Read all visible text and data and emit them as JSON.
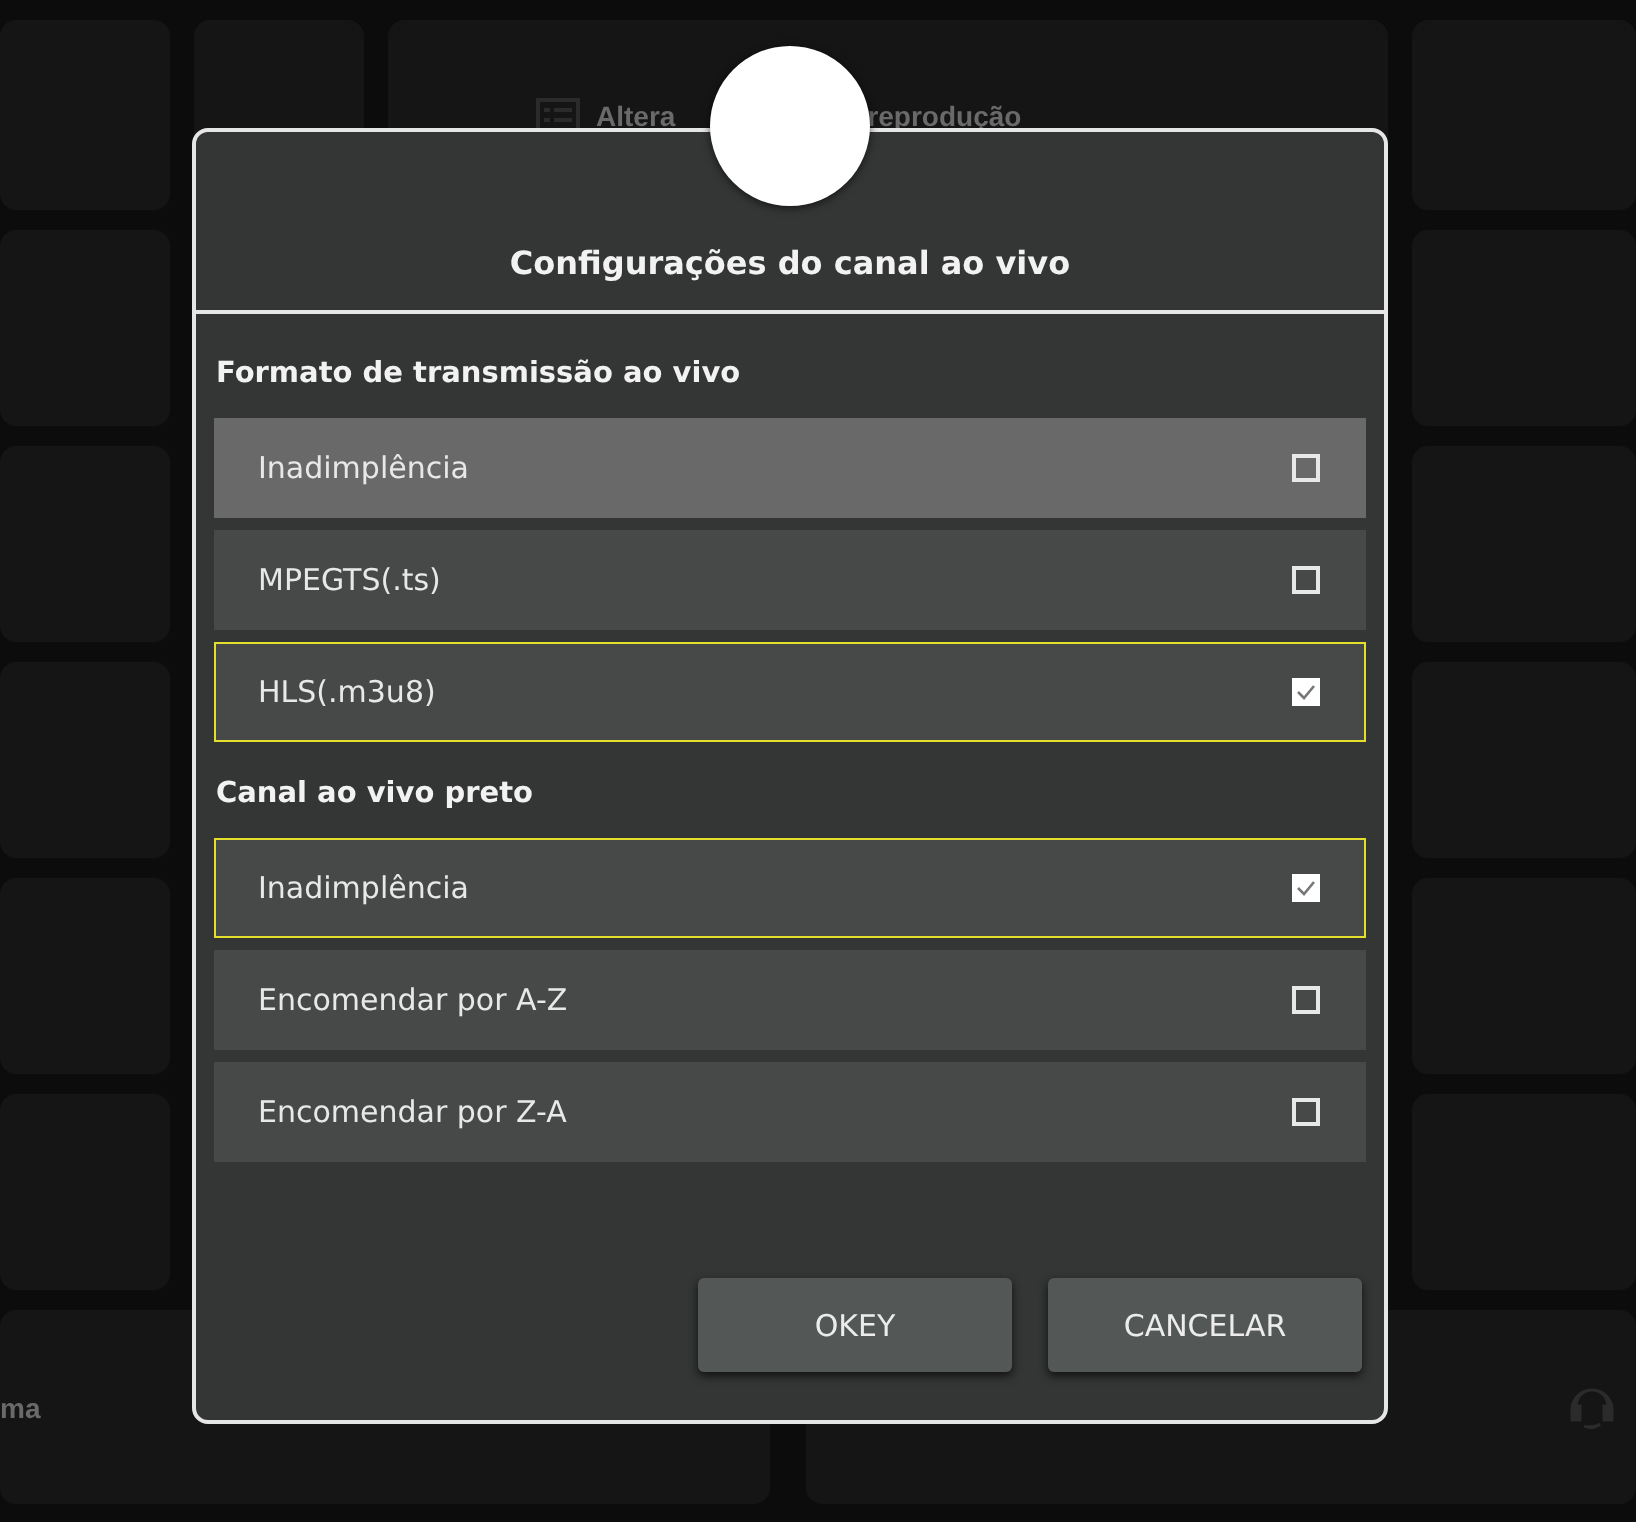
{
  "background": {
    "top_tile": {
      "text_left": "Altera",
      "text_right": "reprodução"
    },
    "bottom_left_tile": {
      "text": "ma"
    }
  },
  "dialog": {
    "title": "Configurações do canal ao vivo",
    "sections": [
      {
        "heading": "Formato de transmissão ao vivo",
        "options": [
          {
            "label": "Inadimplência",
            "checked": false,
            "focused": true
          },
          {
            "label": "MPEGTS(.ts)",
            "checked": false,
            "focused": false
          },
          {
            "label": "HLS(.m3u8)",
            "checked": true,
            "focused": false
          }
        ]
      },
      {
        "heading": "Canal ao vivo preto",
        "options": [
          {
            "label": "Inadimplência",
            "checked": true,
            "focused": false
          },
          {
            "label": "Encomendar por A-Z",
            "checked": false,
            "focused": false
          },
          {
            "label": "Encomendar por Z-A",
            "checked": false,
            "focused": false
          }
        ]
      }
    ],
    "buttons": [
      "OKEY",
      "CANCELAR"
    ]
  }
}
